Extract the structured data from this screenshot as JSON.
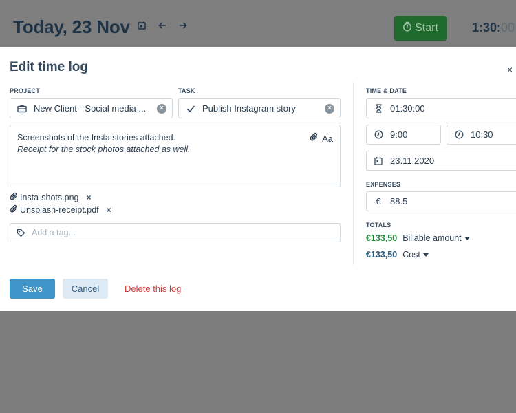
{
  "header": {
    "title": "Today, 23 Nov",
    "start_label": "Start",
    "timer_main": "1:30:",
    "timer_dim": "00"
  },
  "modal": {
    "title": "Edit time log",
    "close_label": "×"
  },
  "project": {
    "label": "PROJECT",
    "value": "New Client - Social media ..."
  },
  "task": {
    "label": "TASK",
    "value": "Publish Instagram story"
  },
  "notes": {
    "line1": "Screenshots of the Insta stories attached.",
    "line2": "Receipt for the stock photos attached as well.",
    "format_label": "Aa"
  },
  "attachments": [
    {
      "name": "Insta-shots.png",
      "remove": "×"
    },
    {
      "name": "Unsplash-receipt.pdf",
      "remove": "×"
    }
  ],
  "tags": {
    "placeholder": "Add a tag..."
  },
  "time_date": {
    "label": "TIME & DATE",
    "duration": "01:30:00",
    "start_time": "9:00",
    "end_time": "10:30",
    "date": "23.11.2020"
  },
  "expenses": {
    "label": "EXPENSES",
    "currency": "€",
    "value": "88.5"
  },
  "totals": {
    "label": "TOTALS",
    "billable_amount": "€133,50",
    "billable_label": "Billable amount",
    "cost_amount": "€133,50",
    "cost_label": "Cost"
  },
  "actions": {
    "save": "Save",
    "cancel": "Cancel",
    "delete": "Delete this log"
  },
  "colors": {
    "overlay": "#7d7d7d",
    "save_button": "#3f94c8",
    "cancel_button": "#dde9f3",
    "delete_text": "#d23b3b",
    "billable_green": "#1d8a3a",
    "cost_blue": "#2b5b7d",
    "start_button": "#1e6b2d"
  },
  "icons": {
    "project": "briefcase-icon",
    "task": "check-icon",
    "duration": "hourglass-icon",
    "start_time": "clock-icon",
    "end_time": "clock-icon",
    "date": "calendar-icon",
    "attachment": "paperclip-icon",
    "tag": "tag-icon"
  }
}
